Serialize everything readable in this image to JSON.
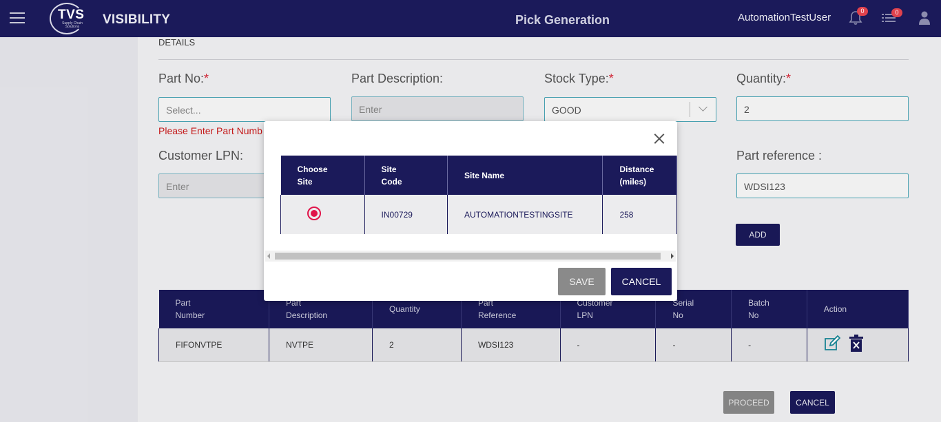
{
  "header": {
    "logo_text": "TVS",
    "logo_sub": "Supply Chain Solutions",
    "app_name": "VISIBILITY",
    "page_title": "Pick Generation",
    "username": "AutomationTestUser",
    "notifications_count": "0",
    "tasks_count": "0"
  },
  "details": {
    "section_title": "DETAILS",
    "part_no": {
      "label": "Part No:",
      "required": "*",
      "placeholder": "Select...",
      "error": "Please Enter Part Numb"
    },
    "part_description": {
      "label": "Part Description:",
      "placeholder": "Enter"
    },
    "stock_type": {
      "label": "Stock Type:",
      "required": "*",
      "value": "GOOD"
    },
    "quantity": {
      "label": "Quantity:",
      "required": "*",
      "value": "2"
    },
    "customer_lpn": {
      "label": "Customer LPN:",
      "placeholder": "Enter"
    },
    "part_reference": {
      "label": "Part reference :",
      "value": "WDSI123"
    },
    "add_label": "ADD"
  },
  "table": {
    "columns": [
      [
        "Part",
        "Number"
      ],
      [
        "Part",
        "Description"
      ],
      [
        "Quantity"
      ],
      [
        "Part",
        "Reference"
      ],
      [
        "Customer",
        "LPN"
      ],
      [
        "Serial",
        "No"
      ],
      [
        "Batch",
        "No"
      ],
      [
        "Action"
      ]
    ],
    "rows": [
      [
        "FIFONVTPE",
        "NVTPE",
        "2",
        "WDSI123",
        "-",
        "-",
        "-"
      ]
    ]
  },
  "footer": {
    "proceed_label": "PROCEED",
    "cancel_label": "CANCEL"
  },
  "modal": {
    "columns": [
      [
        "Choose",
        "Site"
      ],
      [
        "Site",
        "Code"
      ],
      [
        "Site Name"
      ],
      [
        "Distance",
        "(miles)"
      ]
    ],
    "rows": [
      {
        "selected": true,
        "site_code": "IN00729",
        "site_name": "AUTOMATIONTESTINGSITE",
        "distance": "258"
      }
    ],
    "save_label": "SAVE",
    "cancel_label": "CANCEL"
  },
  "colors": {
    "navy": "#1b1a5a",
    "accent_teal": "#4aa7b8",
    "error_red": "#cc1a1a",
    "radio_red": "#e0144a"
  }
}
